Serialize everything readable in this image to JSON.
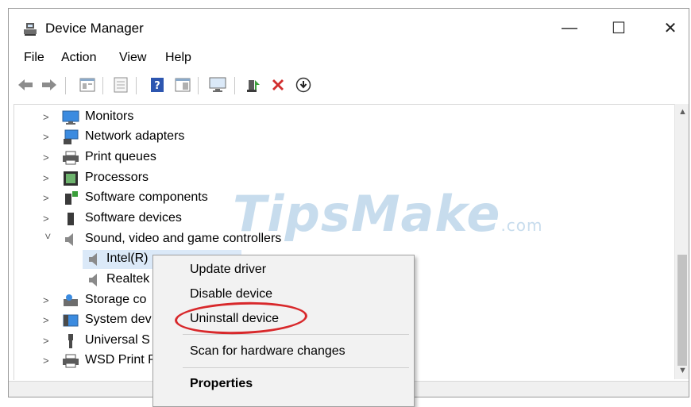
{
  "window": {
    "title": "Device Manager",
    "controls": {
      "minimize": "—",
      "maximize": "☐",
      "close": "✕"
    }
  },
  "menu": [
    "File",
    "Action",
    "View",
    "Help"
  ],
  "toolbar": {
    "icons": [
      "back-arrow-icon",
      "forward-arrow-icon",
      "properties-icon",
      "update-icon",
      "help-icon",
      "view-icon",
      "monitor-icon",
      "enable-device-icon",
      "uninstall-x-icon",
      "download-icon"
    ]
  },
  "tree": {
    "items": [
      {
        "label": "Monitors",
        "expanded": false,
        "icon": "monitor-icon"
      },
      {
        "label": "Network adapters",
        "expanded": false,
        "icon": "network-adapter-icon"
      },
      {
        "label": "Print queues",
        "expanded": false,
        "icon": "printer-icon"
      },
      {
        "label": "Processors",
        "expanded": false,
        "icon": "processor-icon"
      },
      {
        "label": "Software components",
        "expanded": false,
        "icon": "software-component-icon"
      },
      {
        "label": "Software devices",
        "expanded": false,
        "icon": "software-device-icon"
      },
      {
        "label": "Sound, video and game controllers",
        "expanded": true,
        "icon": "speaker-icon"
      },
      {
        "label": "Intel(R)",
        "child": true,
        "selected": true,
        "icon": "speaker-icon"
      },
      {
        "label": "Realtek",
        "child": true,
        "icon": "speaker-icon"
      },
      {
        "label": "Storage co",
        "expanded": false,
        "icon": "storage-icon"
      },
      {
        "label": "System dev",
        "expanded": false,
        "icon": "system-device-icon"
      },
      {
        "label": "Universal S",
        "expanded": false,
        "icon": "usb-icon"
      },
      {
        "label": "WSD Print P",
        "expanded": false,
        "icon": "wsd-printer-icon"
      }
    ]
  },
  "context_menu": {
    "items": [
      "Update driver",
      "Disable device",
      "Uninstall device",
      "Scan for hardware changes",
      "Properties"
    ]
  },
  "watermark": {
    "text": "TipsMake",
    "suffix": ".com"
  },
  "colors": {
    "highlight_circle": "#d8282b",
    "selection": "#dbe9f8",
    "accent_blue": "#2d7fd6"
  }
}
